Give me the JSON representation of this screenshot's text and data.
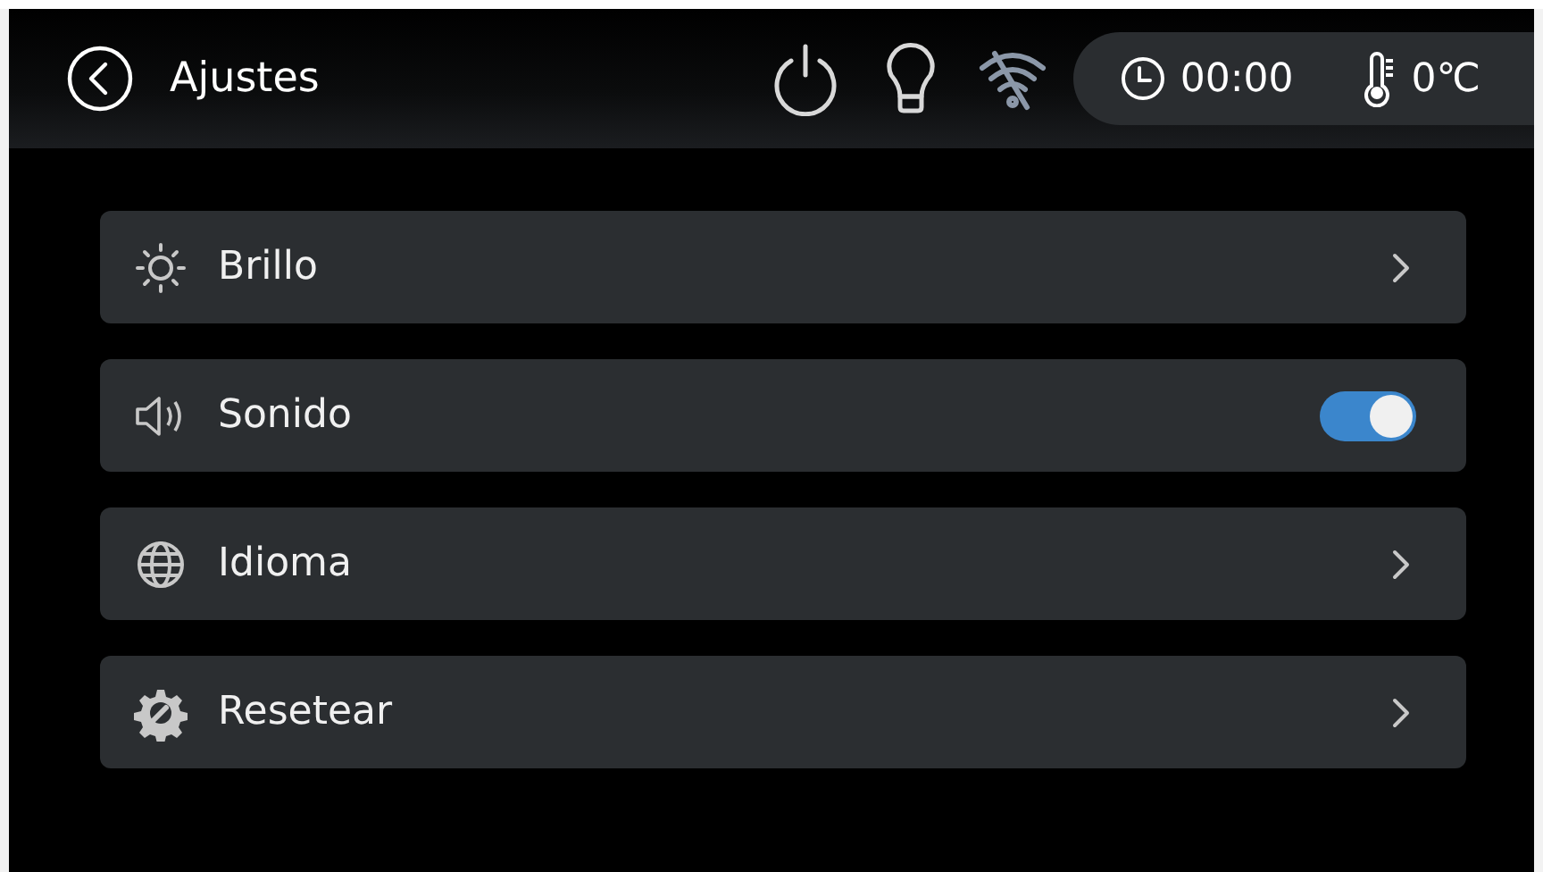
{
  "header": {
    "title": "Ajustes",
    "wifi_connected": false,
    "time": "00:00",
    "temperature": "0℃"
  },
  "items": [
    {
      "kind": "link",
      "label": "Brillo"
    },
    {
      "kind": "toggle",
      "label": "Sonido",
      "on": true
    },
    {
      "kind": "link",
      "label": "Idioma"
    },
    {
      "kind": "link",
      "label": "Resetear"
    }
  ]
}
